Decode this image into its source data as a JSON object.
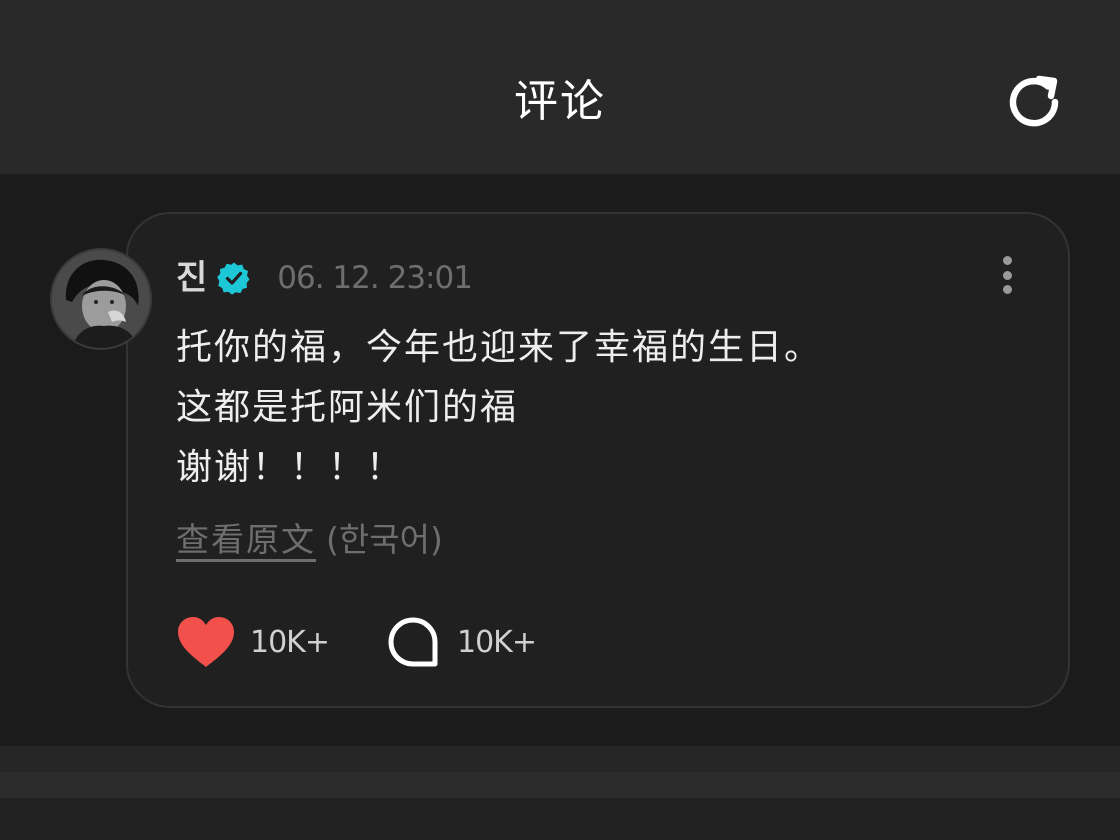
{
  "header": {
    "title": "评论",
    "refresh_icon": "refresh-icon"
  },
  "comment": {
    "author": "진",
    "verified_icon": "verified-badge-icon",
    "timestamp": "06. 12. 23:01",
    "lines": [
      "托你的福，今年也迎来了幸福的生日。",
      "这都是托阿米们的福",
      "谢谢！！！！"
    ],
    "view_original": "查看原文",
    "original_language": "(한국어)",
    "like_count": "10K+",
    "reply_count": "10K+",
    "more_icon": "more-vertical-icon"
  },
  "colors": {
    "header_bg": "#292929",
    "page_bg": "#1b1b1b",
    "card_bg": "#202020",
    "verified": "#1ec7d6",
    "like": "#f2504b"
  }
}
